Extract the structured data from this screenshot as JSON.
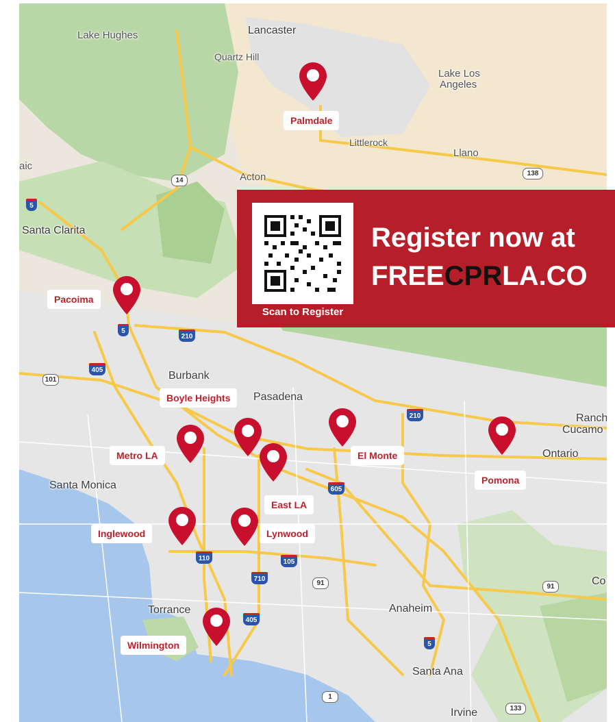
{
  "banner": {
    "headline": "Register now at",
    "url_prefix": "FREE",
    "url_highlight": "CPR",
    "url_suffix": "LA.CO",
    "qr_caption": "Scan to Register",
    "background_color": "#b61f2a",
    "highlight_color": "#111111"
  },
  "map": {
    "places": {
      "lake_hughes": "Lake Hughes",
      "lancaster": "Lancaster",
      "quartz_hill": "Quartz Hill",
      "lake_los_angeles_1": "Lake Los",
      "lake_los_angeles_2": "Angeles",
      "littlerock": "Littlerock",
      "llano": "Llano",
      "aic": "aic",
      "acton": "Acton",
      "santa_clarita": "Santa Clarita",
      "burbank": "Burbank",
      "pasadena": "Pasadena",
      "ranch": "Ranch",
      "cucamo": "Cucamo",
      "ontario": "Ontario",
      "santa_monica": "Santa Monica",
      "torrance": "Torrance",
      "anaheim": "Anaheim",
      "santa_ana": "Santa Ana",
      "irvine": "Irvine",
      "co": "Co"
    },
    "shields": {
      "s14": "14",
      "s138": "138",
      "i5_north": "5",
      "i5_pacoima": "5",
      "i210_west": "210",
      "i405_north": "405",
      "s101": "101",
      "i210_east": "210",
      "i605": "605",
      "i110": "110",
      "i105": "105",
      "i710": "710",
      "s91_west": "91",
      "s91_east": "91",
      "i405_south": "405",
      "i5_south": "5",
      "s1": "1",
      "s133": "133"
    },
    "pin_color": "#c8102e"
  },
  "locations": {
    "palmdale": "Palmdale",
    "pacoima": "Pacoima",
    "boyle_heights": "Boyle Heights",
    "metro_la": "Metro LA",
    "el_monte": "El Monte",
    "pomona": "Pomona",
    "east_la": "East LA",
    "inglewood": "Inglewood",
    "lynwood": "Lynwood",
    "wilmington": "Wilmington"
  }
}
